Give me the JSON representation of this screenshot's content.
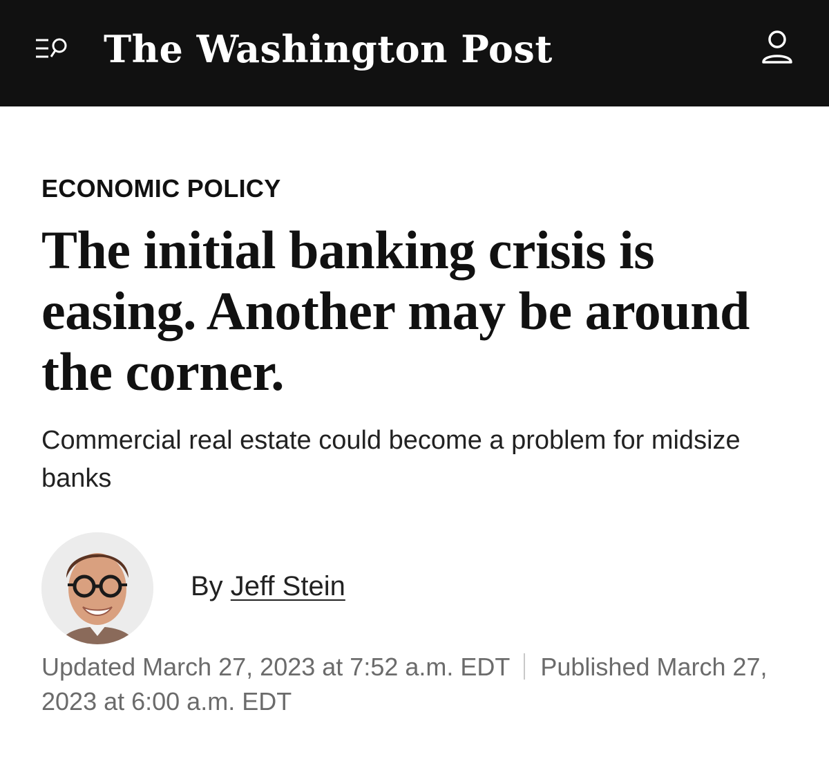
{
  "header": {
    "logo_text": "The Washington Post",
    "menu_icon": "menu-search-icon",
    "account_icon": "user-account-icon",
    "background_color": "#111111",
    "logo_color": "#ffffff"
  },
  "article": {
    "section": "ECONOMIC POLICY",
    "headline": "The initial banking crisis is easing. Another may be around the corner.",
    "dek": "Commercial real estate could become a problem for midsize banks",
    "byline": {
      "prefix": "By ",
      "author": "Jeff Stein",
      "avatar": "author-photo"
    },
    "timestamps": {
      "updated": "Updated March 27, 2023 at 7:52 a.m. EDT",
      "published": "Published March 27, 2023 at 6:00 a.m. EDT"
    }
  }
}
